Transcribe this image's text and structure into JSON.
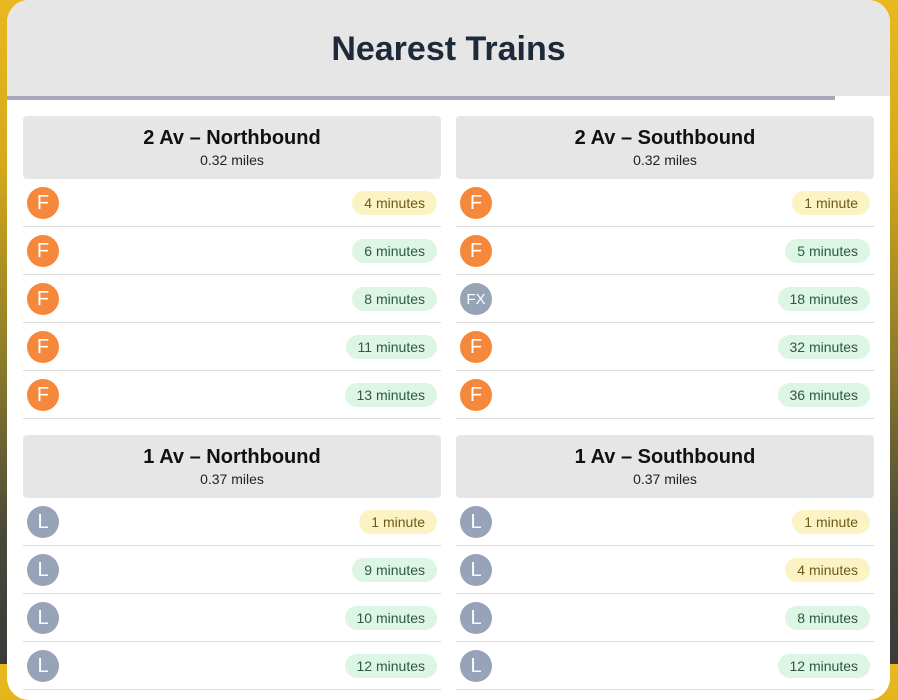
{
  "title": "Nearest Trains",
  "colors": {
    "f_line": "#f5883a",
    "l_line": "#97a3b6",
    "soon": "#fcf3c4",
    "later": "#dcf5e4"
  },
  "sections": [
    {
      "title": "2 Av – Northbound",
      "distance": "0.32 miles",
      "trains": [
        {
          "line": "F",
          "time": "4 minutes",
          "status": "yellow"
        },
        {
          "line": "F",
          "time": "6 minutes",
          "status": "green"
        },
        {
          "line": "F",
          "time": "8 minutes",
          "status": "green"
        },
        {
          "line": "F",
          "time": "11 minutes",
          "status": "green"
        },
        {
          "line": "F",
          "time": "13 minutes",
          "status": "green"
        }
      ]
    },
    {
      "title": "2 Av – Southbound",
      "distance": "0.32 miles",
      "trains": [
        {
          "line": "F",
          "time": "1 minute",
          "status": "yellow"
        },
        {
          "line": "F",
          "time": "5 minutes",
          "status": "green"
        },
        {
          "line": "FX",
          "time": "18 minutes",
          "status": "green"
        },
        {
          "line": "F",
          "time": "32 minutes",
          "status": "green"
        },
        {
          "line": "F",
          "time": "36 minutes",
          "status": "green"
        }
      ]
    },
    {
      "title": "1 Av – Northbound",
      "distance": "0.37 miles",
      "trains": [
        {
          "line": "L",
          "time": "1 minute",
          "status": "yellow"
        },
        {
          "line": "L",
          "time": "9 minutes",
          "status": "green"
        },
        {
          "line": "L",
          "time": "10 minutes",
          "status": "green"
        },
        {
          "line": "L",
          "time": "12 minutes",
          "status": "green"
        }
      ]
    },
    {
      "title": "1 Av – Southbound",
      "distance": "0.37 miles",
      "trains": [
        {
          "line": "L",
          "time": "1 minute",
          "status": "yellow"
        },
        {
          "line": "L",
          "time": "4 minutes",
          "status": "yellow"
        },
        {
          "line": "L",
          "time": "8 minutes",
          "status": "green"
        },
        {
          "line": "L",
          "time": "12 minutes",
          "status": "green"
        }
      ]
    }
  ]
}
